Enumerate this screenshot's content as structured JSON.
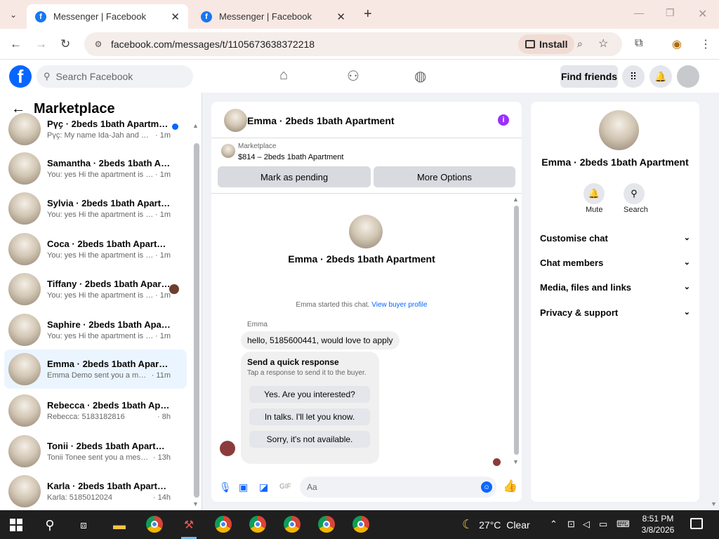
{
  "browser": {
    "tabs": [
      {
        "title": "Messenger | Facebook"
      },
      {
        "title": "Messenger | Facebook"
      }
    ],
    "url": "facebook.com/messages/t/1105673638372218",
    "install_label": "Install"
  },
  "fb": {
    "search_placeholder": "Search Facebook",
    "find_friends": "Find friends"
  },
  "sidebar": {
    "title": "Marketplace",
    "conversations": [
      {
        "name": "Рүҫ · 2beds 1bath Apartment",
        "preview": "Рүҫ: My name Ida-Jah and my ...",
        "time": "· 1m",
        "unread": true
      },
      {
        "name": "Samantha · 2beds 1bath Apart...",
        "preview": "You: yes Hi the apartment is still a...",
        "time": "· 1m"
      },
      {
        "name": "Sylvia · 2beds 1bath Apartment",
        "preview": "You: yes Hi the apartment is still a...",
        "time": "· 1m"
      },
      {
        "name": "Coca · 2beds 1bath Apartment",
        "preview": "You: yes Hi the apartment is still a...",
        "time": "· 1m"
      },
      {
        "name": "Tiffany · 2beds 1bath Apartm...",
        "preview": "You: yes Hi the apartment is stil...",
        "time": "· 1m",
        "seen_avatar": true
      },
      {
        "name": "Saphire · 2beds 1bath Apartment",
        "preview": "You: yes Hi the apartment is still a...",
        "time": "· 1m"
      },
      {
        "name": "Emma · 2beds 1bath Apartment",
        "preview": "Emma Demo sent you a messag...",
        "time": "· 11m",
        "selected": true
      },
      {
        "name": "Rebecca · 2beds 1bath Apartment",
        "preview": "Rebecca: 5183182816",
        "time": "· 8h"
      },
      {
        "name": "Tonii · 2beds 1bath Apartment",
        "preview": "Tonii Tonee sent you a message a...",
        "time": "· 13h"
      },
      {
        "name": "Karla · 2beds 1bath Apartment",
        "preview": "Karla: 5185012024",
        "time": "· 14h"
      }
    ]
  },
  "chat": {
    "title": "Emma · 2beds 1bath Apartment",
    "marketplace_label": "Marketplace",
    "listing": "$814 – 2beds 1bath Apartment",
    "mark_pending": "Mark as pending",
    "more_options": "More Options",
    "profile_name": "Emma · 2beds 1bath Apartment",
    "started_text": "Emma started this chat.",
    "view_profile": "View buyer profile",
    "sender": "Emma",
    "message": "hello, 5185600441, would love to apply",
    "quick_title": "Send a quick response",
    "quick_sub": "Tap a response to send it to the buyer.",
    "quick_options": [
      "Yes. Are you interested?",
      "In talks. I'll let you know.",
      "Sorry, it's not available."
    ],
    "input_placeholder": "Aa"
  },
  "details": {
    "name": "Emma · 2beds 1bath Apartment",
    "mute": "Mute",
    "search": "Search",
    "sections": [
      "Customise chat",
      "Chat members",
      "Media, files and links",
      "Privacy & support"
    ]
  },
  "taskbar": {
    "temperature": "27°C",
    "condition": "Clear",
    "time": "8:51 PM",
    "date": "3/8/2026"
  },
  "colors": {
    "fb_blue": "#0866ff",
    "selected_row": "#ebf5ff",
    "info_purple": "#9b30ff"
  }
}
